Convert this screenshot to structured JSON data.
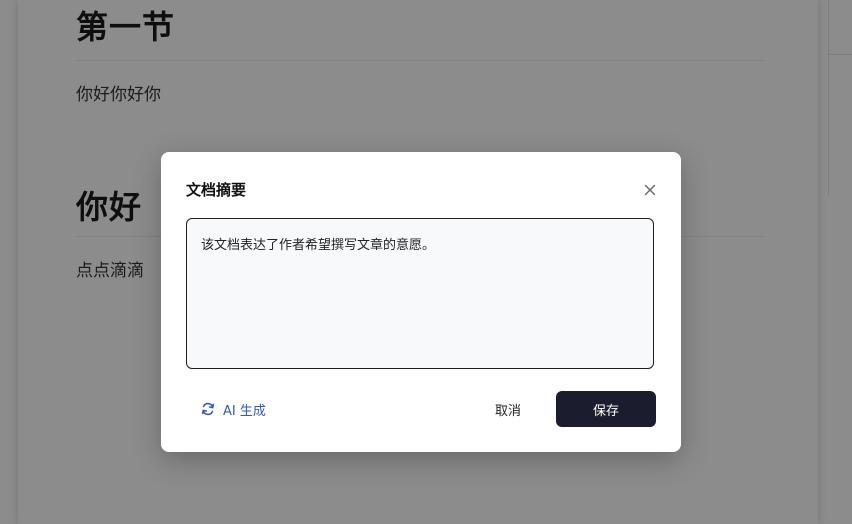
{
  "document": {
    "section1_heading": "第一节",
    "section1_text": "你好你好你",
    "section2_heading": "你好",
    "section2_text": "点点滴滴"
  },
  "modal": {
    "title": "文档摘要",
    "summary_value": "该文档表达了作者希望撰写文章的意愿。",
    "ai_generate_label": "AI 生成",
    "cancel_label": "取消",
    "save_label": "保存"
  },
  "icons": {
    "close": "close-icon",
    "ai_generate": "refresh-icon"
  },
  "colors": {
    "accent_blue": "#2f56d6",
    "save_button_bg": "#1b1c2e",
    "overlay": "rgba(0,0,0,0.45)"
  }
}
